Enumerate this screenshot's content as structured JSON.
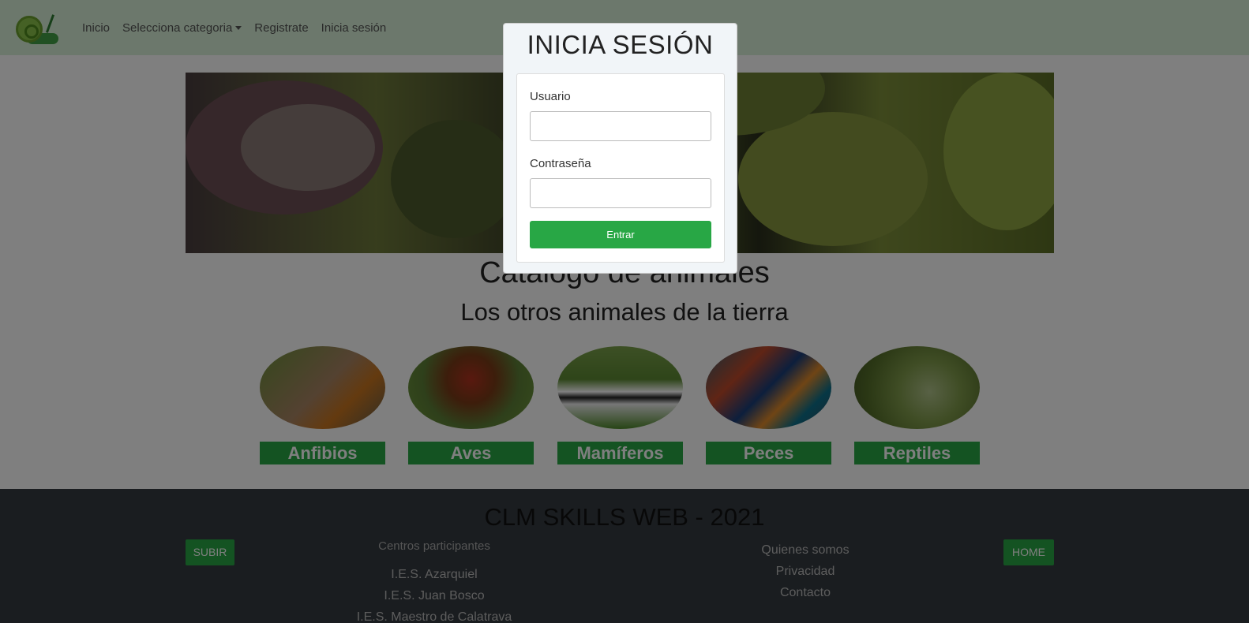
{
  "nav": {
    "home": "Inicio",
    "category": "Selecciona categoria",
    "register": "Registrate",
    "login": "Inicia sesión"
  },
  "main": {
    "title": "Catálogo de animales",
    "subtitle": "Los otros animales de la tierra"
  },
  "categories": [
    {
      "label": "Anfibios"
    },
    {
      "label": "Aves"
    },
    {
      "label": "Mamíferos"
    },
    {
      "label": "Peces"
    },
    {
      "label": "Reptiles"
    }
  ],
  "footer": {
    "title": "CLM SKILLS WEB - 2021",
    "up_button": "SUBIR",
    "home_button": "HOME",
    "centers_heading": "Centros participantes",
    "centers": [
      "I.E.S. Azarquiel",
      "I.E.S. Juan Bosco",
      "I.E.S. Maestro de Calatrava"
    ],
    "links": [
      "Quienes somos",
      "Privacidad",
      "Contacto"
    ]
  },
  "modal": {
    "title": "INICIA SESIÓN",
    "user_label": "Usuario",
    "password_label": "Contraseña",
    "submit_label": "Entrar"
  },
  "colors": {
    "accent": "#28a745",
    "navbar": "#d8f0d8",
    "footer": "#343a40"
  }
}
